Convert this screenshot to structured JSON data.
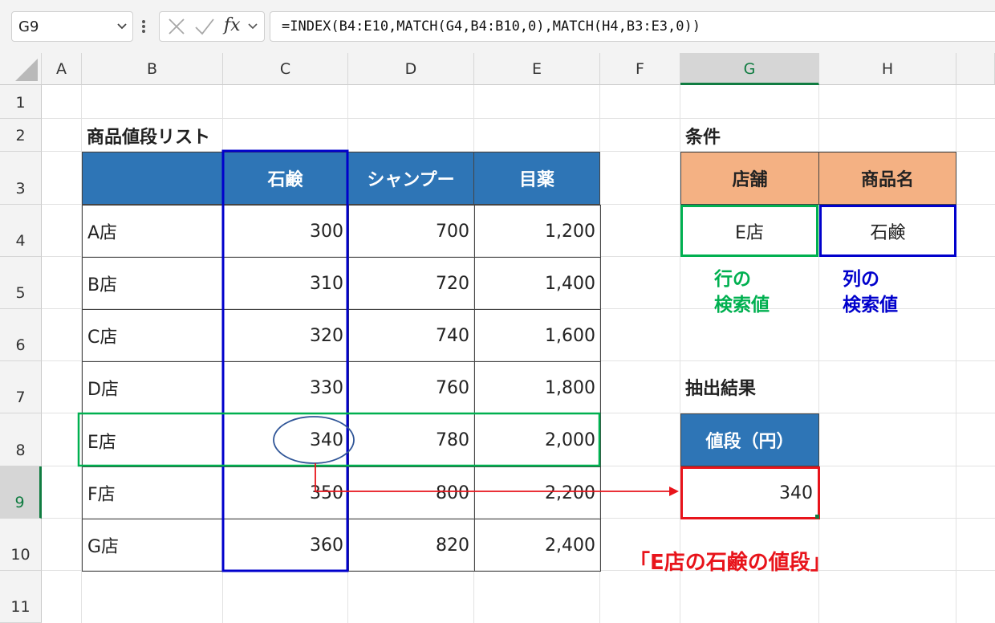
{
  "formula_bar": {
    "name_box": "G9",
    "fx_label": "fx",
    "formula": "=INDEX(B4:E10,MATCH(G4,B4:B10,0),MATCH(H4,B3:E3,0))"
  },
  "columns": [
    "A",
    "B",
    "C",
    "D",
    "E",
    "F",
    "G",
    "H"
  ],
  "rows": [
    "1",
    "2",
    "3",
    "4",
    "5",
    "6",
    "7",
    "8",
    "9",
    "10",
    "11"
  ],
  "selected_cell": "G9",
  "price_list": {
    "title": "商品値段リスト",
    "headers": [
      "",
      "石鹸",
      "シャンプー",
      "目薬"
    ],
    "stores": [
      {
        "name": "A店",
        "soap": "300",
        "shampoo": "700",
        "eyedrops": "1,200"
      },
      {
        "name": "B店",
        "soap": "310",
        "shampoo": "720",
        "eyedrops": "1,400"
      },
      {
        "name": "C店",
        "soap": "320",
        "shampoo": "740",
        "eyedrops": "1,600"
      },
      {
        "name": "D店",
        "soap": "330",
        "shampoo": "760",
        "eyedrops": "1,800"
      },
      {
        "name": "E店",
        "soap": "340",
        "shampoo": "780",
        "eyedrops": "2,000"
      },
      {
        "name": "F店",
        "soap": "350",
        "shampoo": "800",
        "eyedrops": "2,200"
      },
      {
        "name": "G店",
        "soap": "360",
        "shampoo": "820",
        "eyedrops": "2,400"
      }
    ]
  },
  "conditions": {
    "title": "条件",
    "store_header": "店舗",
    "product_header": "商品名",
    "store_value": "E店",
    "product_value": "石鹸",
    "row_note_1": "行の",
    "row_note_2": "検索値",
    "col_note_1": "列の",
    "col_note_2": "検索値"
  },
  "result": {
    "title": "抽出結果",
    "header": "値段（円）",
    "value": "340"
  },
  "callout": "「E店の石鹸の値段」",
  "colors": {
    "header_blue": "#2e75b6",
    "header_orange": "#f4b183",
    "green_highlight": "#00b050",
    "blue_highlight": "#0000cc",
    "red_highlight": "#e8141b",
    "excel_green": "#107c41"
  }
}
